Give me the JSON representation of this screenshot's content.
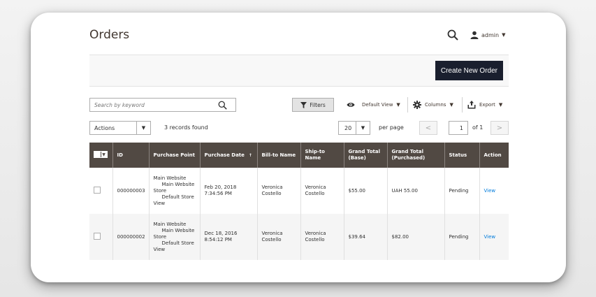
{
  "header": {
    "title": "Orders",
    "user_name": "admin"
  },
  "action_bar": {
    "create_label": "Create New Order"
  },
  "toolbar": {
    "search_placeholder": "Search by keyword",
    "filters_label": "Filters",
    "view_label": "Default View",
    "columns_label": "Columns",
    "export_label": "Export",
    "actions_label": "Actions",
    "records_found": "3 records found",
    "per_page_value": "20",
    "per_page_label": "per page",
    "current_page": "1",
    "of_pages": "of 1",
    "prev_glyph": "<",
    "next_glyph": ">"
  },
  "table": {
    "columns": [
      "ID",
      "Purchase Point",
      "Purchase Date",
      "Bill-to Name",
      "Ship-to Name",
      "Grand Total (Base)",
      "Grand Total (Purchased)",
      "Status",
      "Action"
    ],
    "rows": [
      {
        "id": "000000003",
        "purchase_point": [
          "Main Website",
          "Main Website",
          "Store",
          "Default Store",
          "View"
        ],
        "purchase_date": [
          "Feb 20, 2018",
          "7:34:56 PM"
        ],
        "bill_to": [
          "Veronica",
          "Costello"
        ],
        "ship_to": [
          "Veronica",
          "Costello"
        ],
        "total_base": "$55.00",
        "total_purchased": "UAH 55.00",
        "status": "Pending",
        "action": "View"
      },
      {
        "id": "000000002",
        "purchase_point": [
          "Main Website",
          "Main Website",
          "Store",
          "Default Store",
          "View"
        ],
        "purchase_date": [
          "Dec 18, 2016",
          "8:54:12 PM"
        ],
        "bill_to": [
          "Veronica",
          "Costello"
        ],
        "ship_to": [
          "Veronica",
          "Costello"
        ],
        "total_base": "$39.64",
        "total_purchased": "$82.00",
        "status": "Pending",
        "action": "View"
      }
    ]
  },
  "colors": {
    "header_bg": "#514943",
    "primary_button": "#1a1f2e",
    "link": "#007bdb"
  }
}
